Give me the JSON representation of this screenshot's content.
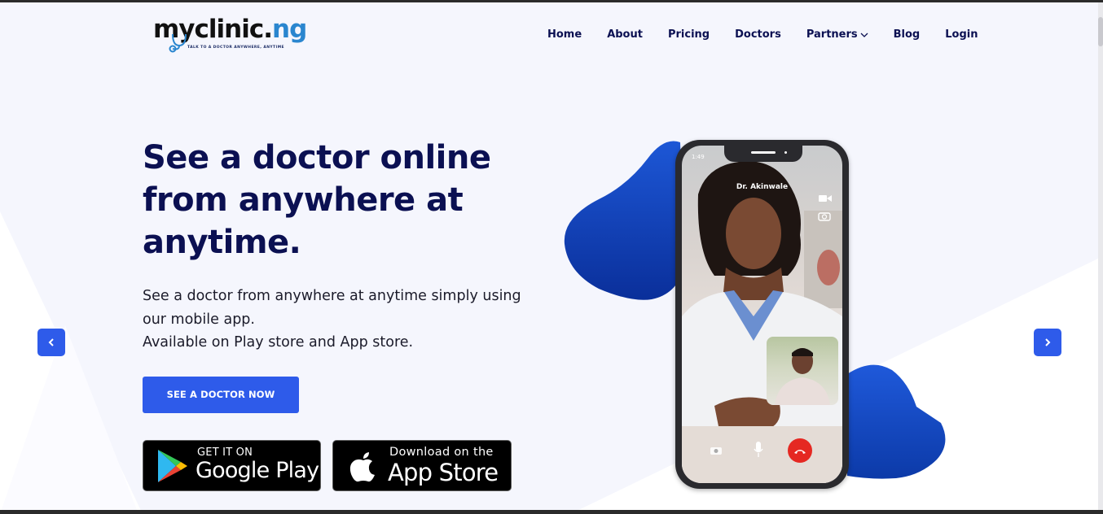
{
  "brand": {
    "name_main": "myclinic.",
    "name_tld": "ng",
    "tagline": "TALK TO A DOCTOR ANYWHERE, ANYTIME"
  },
  "nav": {
    "items": [
      "Home",
      "About",
      "Pricing",
      "Doctors",
      "Partners",
      "Blog",
      "Login"
    ]
  },
  "hero": {
    "title": "See a doctor online from anywhere at anytime.",
    "desc_line1": "See a doctor from anywhere at anytime simply using",
    "desc_line2": "our mobile app.",
    "desc_line3": "Available on Play store and App store.",
    "cta_label": "SEE A DOCTOR NOW"
  },
  "stores": {
    "google_small": "GET IT ON",
    "google_big": "Google Play",
    "apple_small": "Download on the",
    "apple_big": "App Store"
  },
  "phone": {
    "status_time": "1:49",
    "caller_name": "Dr. Akinwale"
  },
  "colors": {
    "primary": "#2e5bea",
    "heading": "#0b1052",
    "blob": "#0f3fb3",
    "hangup": "#e52822"
  },
  "icons": [
    "chevron-down-icon",
    "chevron-left-icon",
    "chevron-right-icon",
    "google-play-icon",
    "apple-icon",
    "camera-icon",
    "mic-icon",
    "hangup-icon",
    "video-icon",
    "switch-camera-icon"
  ]
}
